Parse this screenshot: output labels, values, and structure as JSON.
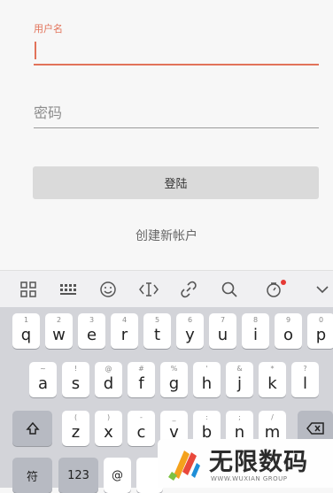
{
  "form": {
    "username_label": "用户名",
    "username_value": "",
    "password_placeholder": "密码",
    "login_label": "登陆",
    "create_account_label": "创建新帐户"
  },
  "toolbar": {
    "icons": [
      "apps-grid-icon",
      "keyboard-layout-icon",
      "emoji-icon",
      "cursor-move-icon",
      "link-icon",
      "search-icon",
      "sticker-icon",
      "collapse-chevron-icon"
    ],
    "badge_color": "#e53935"
  },
  "keyboard": {
    "row1": [
      {
        "main": "q",
        "sub": "1"
      },
      {
        "main": "w",
        "sub": "2"
      },
      {
        "main": "e",
        "sub": "3"
      },
      {
        "main": "r",
        "sub": "4"
      },
      {
        "main": "t",
        "sub": "5"
      },
      {
        "main": "y",
        "sub": "6"
      },
      {
        "main": "u",
        "sub": "7"
      },
      {
        "main": "i",
        "sub": "8"
      },
      {
        "main": "o",
        "sub": "9"
      },
      {
        "main": "p",
        "sub": "0"
      }
    ],
    "row2": [
      {
        "main": "a",
        "sub": "~"
      },
      {
        "main": "s",
        "sub": "!"
      },
      {
        "main": "d",
        "sub": "@"
      },
      {
        "main": "f",
        "sub": "#"
      },
      {
        "main": "g",
        "sub": "%"
      },
      {
        "main": "h",
        "sub": "'"
      },
      {
        "main": "j",
        "sub": "&"
      },
      {
        "main": "k",
        "sub": "*"
      },
      {
        "main": "l",
        "sub": "?"
      }
    ],
    "row3": [
      {
        "main": "z",
        "sub": "("
      },
      {
        "main": "x",
        "sub": ")"
      },
      {
        "main": "c",
        "sub": "-"
      },
      {
        "main": "v",
        "sub": "_"
      },
      {
        "main": "b",
        "sub": ":"
      },
      {
        "main": "n",
        "sub": ";"
      },
      {
        "main": "m",
        "sub": "/"
      }
    ],
    "symbol_key": "符",
    "number_key": "123",
    "at_key": "@"
  },
  "watermark": {
    "title": "无限数码",
    "subtitle": "WWW.WUXIAN GROUP"
  },
  "colors": {
    "accent": "#e2735a",
    "keyboard_bg": "#d3d4d9"
  }
}
